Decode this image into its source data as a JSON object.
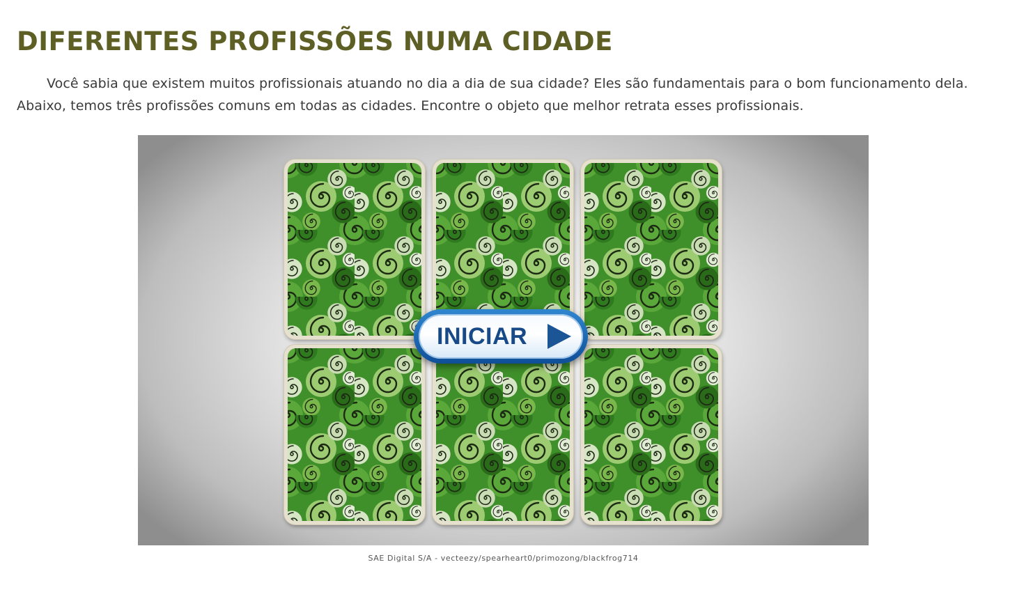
{
  "page": {
    "title": "DIFERENTES PROFISSÕES NUMA CIDADE",
    "intro": "Você sabia que existem muitos profissionais atuando no dia a dia de sua cidade? Eles são fundamentais para o bom funcionamento dela. Abaixo, temos três profissões comuns em todas as cidades. Encontre o objeto que melhor retrata esses profissionais."
  },
  "game": {
    "start_label": "INICIAR",
    "start_icon": "play-arrow-icon",
    "cards": [
      {
        "state": "face-down",
        "pattern": "green-swirl-pattern"
      },
      {
        "state": "face-down",
        "pattern": "green-swirl-pattern"
      },
      {
        "state": "face-down",
        "pattern": "green-swirl-pattern"
      },
      {
        "state": "face-down",
        "pattern": "green-swirl-pattern"
      },
      {
        "state": "face-down",
        "pattern": "green-swirl-pattern"
      },
      {
        "state": "face-down",
        "pattern": "green-swirl-pattern"
      }
    ],
    "credit": "SAE Digital S/A - vecteezy/spearheart0/primozong/blackfrog714"
  },
  "colors": {
    "title": "#5e5f25",
    "button_blue": "#174a86",
    "card_green_dark": "#2e7d1e",
    "card_green_light": "#8cc63f"
  }
}
